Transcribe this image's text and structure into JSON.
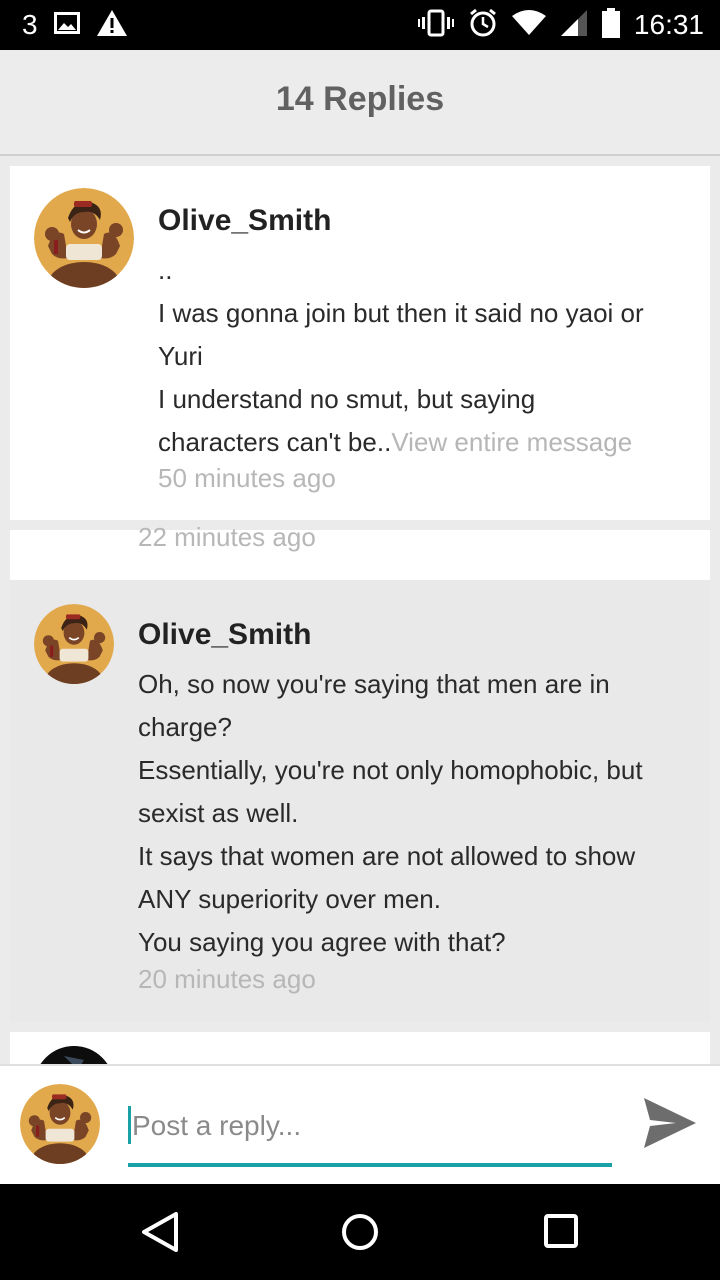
{
  "status_bar": {
    "notification_count": "3",
    "time": "16:31",
    "icons": [
      "image-icon",
      "warning-icon",
      "vibrate-icon",
      "alarm-icon",
      "wifi-icon",
      "signal-icon",
      "battery-icon"
    ]
  },
  "header": {
    "title": "14 Replies"
  },
  "replies": [
    {
      "author": "Olive_Smith",
      "lines": [
        "..",
        "I was gonna join but then it said no yaoi or",
        "Yuri",
        "I understand no smut, but saying"
      ],
      "last_line": "characters can't be..",
      "view_more": "View entire message",
      "time": "50 minutes ago"
    },
    {
      "time": "22 minutes ago"
    },
    {
      "author": "Olive_Smith",
      "lines": [
        "Oh, so now you're saying that men are in",
        "charge?",
        "Essentially, you're not only homophobic, but",
        "sexist as well.",
        "It says that women are not allowed to show",
        "ANY superiority over men.",
        "You saying you agree with that?"
      ],
      "time": "20 minutes ago"
    }
  ],
  "composer": {
    "placeholder": "Post a reply..."
  },
  "colors": {
    "accent": "#1aa1a8",
    "header_bg": "#ececec",
    "highlight_bg": "#e8e9e8"
  },
  "nav": {
    "icons": [
      "back-icon",
      "home-icon",
      "recents-icon"
    ]
  }
}
